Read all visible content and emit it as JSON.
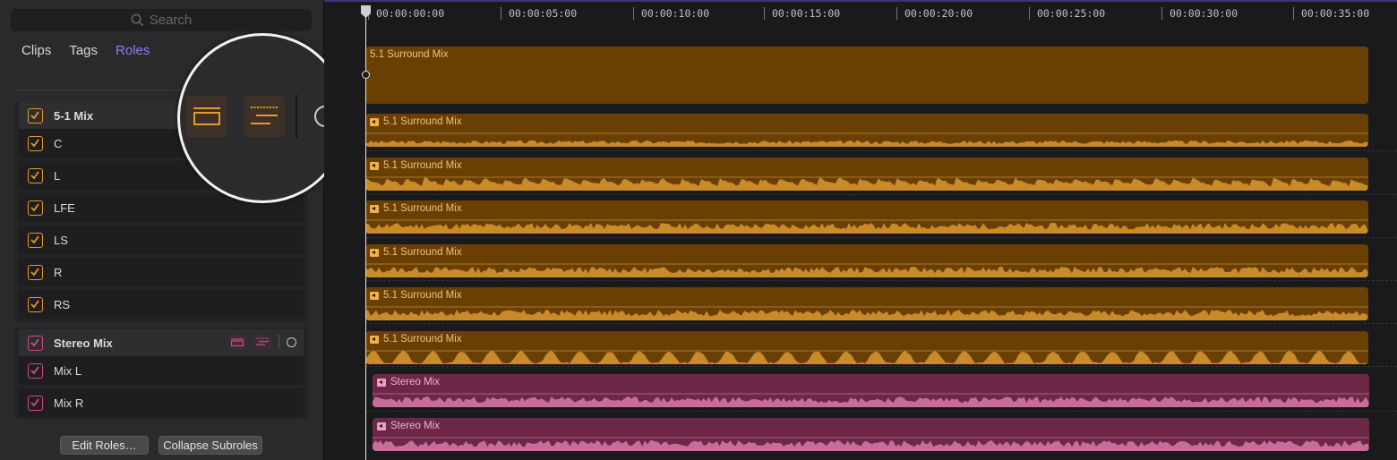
{
  "sidebar": {
    "search_placeholder": "Search",
    "tabs": [
      {
        "label": "Clips",
        "active": false
      },
      {
        "label": "Tags",
        "active": false
      },
      {
        "label": "Roles",
        "active": true
      }
    ],
    "groups": [
      {
        "name": "5-1 Mix",
        "color": "#e09a2e",
        "checked": true,
        "subroles": [
          {
            "name": "C",
            "checked": true
          },
          {
            "name": "L",
            "checked": true
          },
          {
            "name": "LFE",
            "checked": true
          },
          {
            "name": "LS",
            "checked": true
          },
          {
            "name": "R",
            "checked": true
          },
          {
            "name": "RS",
            "checked": true
          }
        ]
      },
      {
        "name": "Stereo Mix",
        "color": "#d24a8c",
        "checked": true,
        "subroles": [
          {
            "name": "Mix L",
            "checked": true
          },
          {
            "name": "Mix R",
            "checked": true
          }
        ]
      }
    ],
    "footer": {
      "edit_roles_label": "Edit Roles…",
      "collapse_subroles_label": "Collapse Subroles"
    },
    "magnifier_icons": [
      "lane-icon",
      "subrole-lanes-icon",
      "focus-circle-icon"
    ]
  },
  "timeline": {
    "ruler_ticks": [
      "00:00:00:00",
      "00:00:05:00",
      "00:00:10:00",
      "00:00:15:00",
      "00:00:20:00",
      "00:00:25:00",
      "00:00:30:00",
      "00:00:35:00"
    ],
    "clips": [
      {
        "label": "5.1 Surround Mix",
        "color": "orange",
        "kind": "compound",
        "has_speaker_icon": false
      },
      {
        "label": "5.1 Surround Mix",
        "color": "orange",
        "kind": "audio",
        "has_speaker_icon": true
      },
      {
        "label": "5.1 Surround Mix",
        "color": "orange",
        "kind": "audio",
        "has_speaker_icon": true
      },
      {
        "label": "5.1 Surround Mix",
        "color": "orange",
        "kind": "audio",
        "has_speaker_icon": true
      },
      {
        "label": "5.1 Surround Mix",
        "color": "orange",
        "kind": "audio",
        "has_speaker_icon": true
      },
      {
        "label": "5.1 Surround Mix",
        "color": "orange",
        "kind": "audio",
        "has_speaker_icon": true
      },
      {
        "label": "5.1 Surround Mix",
        "color": "orange",
        "kind": "audio",
        "has_speaker_icon": true
      },
      {
        "label": "Stereo Mix",
        "color": "pink",
        "kind": "audio",
        "has_speaker_icon": true
      },
      {
        "label": "Stereo Mix",
        "color": "pink",
        "kind": "audio",
        "has_speaker_icon": true
      }
    ],
    "colors": {
      "orange_clip": "#6a3f04",
      "orange_wave": "#c98a2a",
      "pink_clip": "#6d2747",
      "pink_wave": "#c76d9b",
      "roles_tab_accent": "#8e7cf5"
    }
  }
}
